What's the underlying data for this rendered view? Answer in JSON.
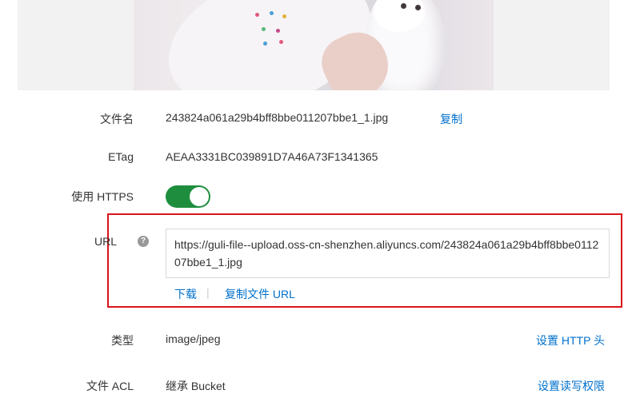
{
  "preview": {
    "alt_icon": "image-preview"
  },
  "fields": {
    "filename_label": "文件名",
    "filename_value": "243824a061a29b4bff8bbe011207bbe1_1.jpg",
    "copy_link": "复制",
    "etag_label": "ETag",
    "etag_value": "AEAA3331BC039891D7A46A73F1341365",
    "https_label": "使用 HTTPS",
    "https_enabled": true,
    "url_label": "URL",
    "url_value": "https://guli-file--upload.oss-cn-shenzhen.aliyuncs.com/243824a061a29b4bff8bbe011207bbe1_1.jpg",
    "download_link": "下载",
    "link_separator": "|",
    "copy_url_link": "复制文件 URL",
    "type_label": "类型",
    "type_value": "image/jpeg",
    "set_http_header_link": "设置 HTTP 头",
    "acl_label": "文件 ACL",
    "acl_value": "继承 Bucket",
    "set_acl_link": "设置读写权限"
  },
  "colors": {
    "link": "#0070cc",
    "toggle_on": "#1e8e3e",
    "highlight_border": "#d9141b"
  }
}
